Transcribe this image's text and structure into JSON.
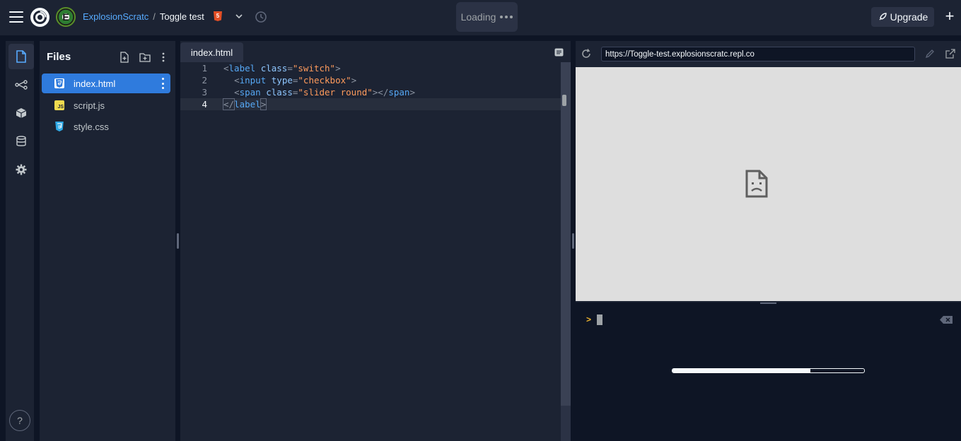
{
  "header": {
    "owner": "ExplosionScratc",
    "separator": "/",
    "repl_name": "Toggle test",
    "language_badge": "5",
    "loading_label": "Loading",
    "upgrade_label": "Upgrade"
  },
  "sidebar": {
    "files_title": "Files",
    "files": [
      {
        "name": "index.html",
        "icon": "html-file-icon",
        "active": true
      },
      {
        "name": "script.js",
        "icon": "js-file-icon",
        "badge": "JS",
        "active": false
      },
      {
        "name": "style.css",
        "icon": "css-file-icon",
        "active": false
      }
    ],
    "help_label": "?"
  },
  "editor": {
    "tab_label": "index.html",
    "current_line": 4,
    "lines": [
      {
        "number": "1"
      },
      {
        "number": "2"
      },
      {
        "number": "3"
      },
      {
        "number": "4"
      }
    ],
    "code": {
      "l1_open": "<",
      "l1_tag": "label",
      "l1_attr": "class",
      "l1_eq": "=",
      "l1_val": "\"switch\"",
      "l1_close": ">",
      "l2_open": "<",
      "l2_tag": "input",
      "l2_attr": "type",
      "l2_eq": "=",
      "l2_val": "\"checkbox\"",
      "l2_close": ">",
      "l3_open": "<",
      "l3_tag": "span",
      "l3_attr": "class",
      "l3_eq": "=",
      "l3_val": "\"slider round\"",
      "l3_close": "></",
      "l3_tag2": "span",
      "l3_close2": ">",
      "l4_open": "</",
      "l4_tag": "label",
      "l4_close": ">"
    }
  },
  "preview": {
    "url": "https://Toggle-test.explosionscratc.repl.co"
  },
  "console": {
    "prompt": ">",
    "progress_fraction": 0.72
  },
  "colors": {
    "accent": "#2f7bdd",
    "link": "#57abff",
    "html_badge": "#e34f26",
    "js_badge": "#f0db4f",
    "css_badge": "#2965f1"
  }
}
